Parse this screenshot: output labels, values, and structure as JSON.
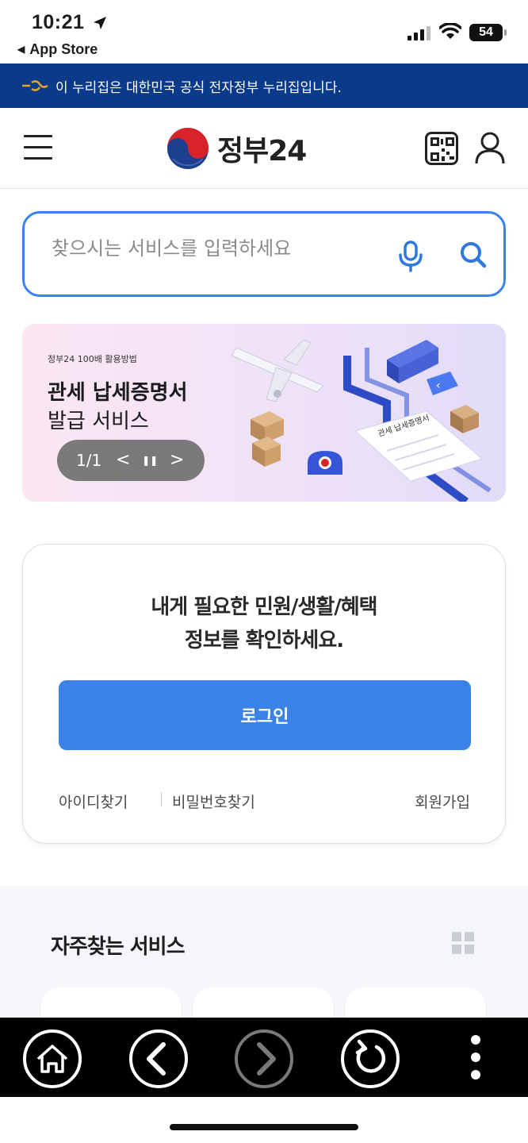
{
  "status_bar": {
    "time": "10:21",
    "back_app": "App Store",
    "battery": "54"
  },
  "gov_banner": {
    "text": "이 누리집은 대한민국 공식 전자정부 누리집입니다."
  },
  "header": {
    "logo_text": "정부24"
  },
  "search": {
    "placeholder": "찾으시는 서비스를 입력하세요"
  },
  "promo": {
    "subtitle": "정부24 100배 활용방법",
    "title_line1": "관세 납세증명서",
    "title_line2": "발급 서비스",
    "counter": "1/1",
    "prev_glyph": "<",
    "pause_glyph": "❚❚",
    "next_glyph": ">",
    "document_label": "관세 납세증명서"
  },
  "login": {
    "message_line1": "내게 필요한 민원/생활/혜택",
    "message_line2": "정보를 확인하세요.",
    "login_label": "로그인",
    "find_id_label": "아이디찾기",
    "find_pw_label": "비밀번호찾기",
    "join_label": "회원가입"
  },
  "frequent": {
    "title": "자주찾는 서비스"
  },
  "colors": {
    "gov_banner_bg": "#0b3a8a",
    "accent_blue": "#3a82e8",
    "search_border": "#3b82f0",
    "toolbar_bg": "#000000"
  },
  "icons": {
    "status": [
      "location-arrow-icon",
      "signal-icon",
      "wifi-icon",
      "battery-icon"
    ],
    "header": [
      "menu-icon",
      "qr-code-icon",
      "user-icon"
    ],
    "search": [
      "microphone-icon",
      "search-icon"
    ],
    "toolbar": [
      "home-icon",
      "back-icon",
      "forward-icon",
      "refresh-icon",
      "more-icon"
    ]
  }
}
